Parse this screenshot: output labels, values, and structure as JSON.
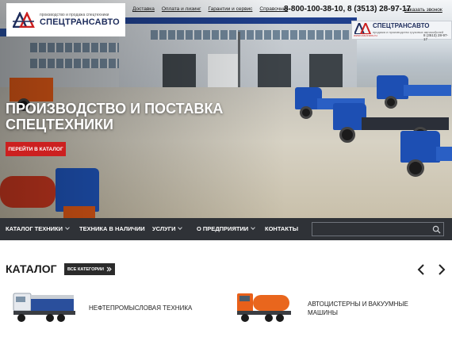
{
  "header": {
    "logo": {
      "tagline": "производство и продажа спецтехники",
      "name": "СПЕЦТРАНСАВТО"
    },
    "top_links": [
      "Доставка",
      "Оплата и лизинг",
      "Гарантии и сервис",
      "Справочник"
    ],
    "phones": "8-800-100-38-10, 8 (3513) 28-97-17",
    "callback": "заказать звонок"
  },
  "signboard": {
    "name": "СПЕЦТРАНСАВТО",
    "tag": "продажа и производство грузовых автомобилей",
    "site": "www.cta-trans.ru",
    "phone": "8 (3513) 28-97-17"
  },
  "hero": {
    "title_line1": "ПРОИЗВОДСТВО И ПОСТАВКА",
    "title_line2": "СПЕЦТЕХНИКИ",
    "cta": "ПЕРЕЙТИ В КАТАЛОГ"
  },
  "nav": {
    "items": [
      {
        "label": "КАТАЛОГ ТЕХНИКИ",
        "has_dropdown": true
      },
      {
        "label": "ТЕХНИКА В НАЛИЧИИ",
        "has_dropdown": false
      },
      {
        "label": "УСЛУГИ",
        "has_dropdown": true
      },
      {
        "label": "О ПРЕДПРИЯТИИ",
        "has_dropdown": true
      },
      {
        "label": "КОНТАКТЫ",
        "has_dropdown": false
      }
    ],
    "search_placeholder": ""
  },
  "catalog": {
    "title": "КАТАЛОГ",
    "all_button": "ВСЕ КАТЕГОРИИ",
    "items": [
      {
        "label": "НЕФТЕПРОМЫСЛОВАЯ ТЕХНИКА"
      },
      {
        "label_line1": "АВТОЦИСТЕРНЫ И ВАКУУМНЫЕ",
        "label_line2": "МАШИНЫ"
      }
    ]
  },
  "colors": {
    "accent_red": "#cc2020",
    "nav_bg": "#2f3237",
    "brand_blue": "#1e2d5c"
  }
}
